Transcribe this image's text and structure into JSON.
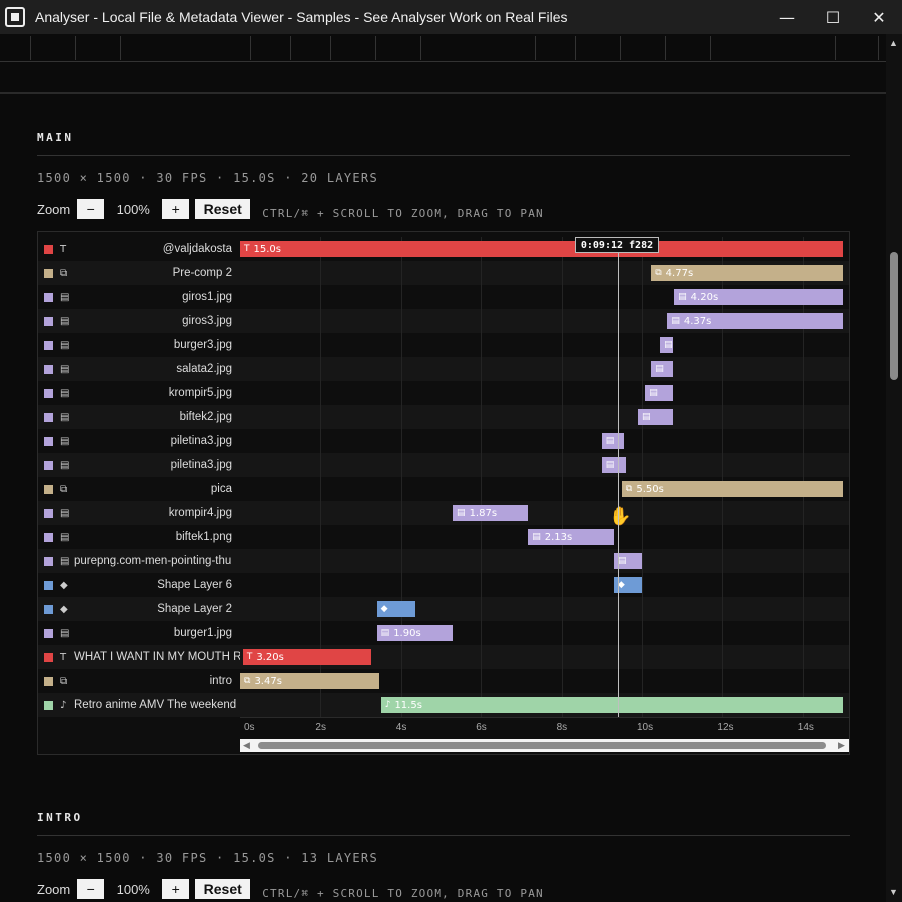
{
  "window": {
    "title": "Analyser - Local File & Metadata Viewer - Samples - See Analyser Work on Real Files",
    "minimize": "—",
    "maximize": "☐",
    "close": "✕"
  },
  "sections": [
    {
      "title": "MAIN",
      "meta": "1500 × 1500 · 30 FPS · 15.0S · 20 LAYERS",
      "zoom": {
        "label": "Zoom",
        "minus": "−",
        "value": "100%",
        "plus": "+",
        "reset": "Reset",
        "hint": "CTRL/⌘ + SCROLL TO ZOOM, DRAG TO PAN"
      }
    },
    {
      "title": "INTRO",
      "meta": "1500 × 1500 · 30 FPS · 15.0S · 13 LAYERS",
      "zoom": {
        "label": "Zoom",
        "minus": "−",
        "value": "100%",
        "plus": "+",
        "reset": "Reset",
        "hint": "CTRL/⌘ + SCROLL TO ZOOM, DRAG TO PAN"
      }
    }
  ],
  "colors": {
    "text": "#e04545",
    "precomp": "#c4b08a",
    "image": "#b3a3db",
    "shape": "#6e9bd6",
    "audio": "#9fd4a8"
  },
  "type_icons": {
    "text": "T",
    "precomp": "⧉",
    "image": "▤",
    "shape": "◆",
    "audio": "♪"
  },
  "timeline": {
    "duration": 15.0,
    "playhead": {
      "time": 9.4,
      "label": "0:09:12 f282"
    },
    "ticks": [
      "0s",
      "2s",
      "4s",
      "6s",
      "8s",
      "10s",
      "12s",
      "14s"
    ],
    "layers": [
      {
        "name": "@valjdakosta",
        "type": "text",
        "start": 0.0,
        "end": 15.0,
        "label": "15.0s"
      },
      {
        "name": "Pre-comp 2",
        "type": "precomp",
        "start": 10.23,
        "end": 15.0,
        "label": "4.77s"
      },
      {
        "name": "giros1.jpg",
        "type": "image",
        "start": 10.8,
        "end": 15.0,
        "label": "4.20s"
      },
      {
        "name": "giros3.jpg",
        "type": "image",
        "start": 10.63,
        "end": 15.0,
        "label": "4.37s"
      },
      {
        "name": "burger3.jpg",
        "type": "image",
        "start": 10.45,
        "end": 10.78,
        "label": ""
      },
      {
        "name": "salata2.jpg",
        "type": "image",
        "start": 10.23,
        "end": 10.78,
        "label": ""
      },
      {
        "name": "krompir5.jpg",
        "type": "image",
        "start": 10.08,
        "end": 10.78,
        "label": ""
      },
      {
        "name": "biftek2.jpg",
        "type": "image",
        "start": 9.9,
        "end": 10.78,
        "label": ""
      },
      {
        "name": "piletina3.jpg",
        "type": "image",
        "start": 9.0,
        "end": 9.55,
        "label": ""
      },
      {
        "name": "piletina3.jpg",
        "type": "image",
        "start": 9.0,
        "end": 9.6,
        "label": ""
      },
      {
        "name": "pica",
        "type": "precomp",
        "start": 9.5,
        "end": 15.0,
        "label": "5.50s"
      },
      {
        "name": "krompir4.jpg",
        "type": "image",
        "start": 5.3,
        "end": 7.17,
        "label": "1.87s"
      },
      {
        "name": "biftek1.png",
        "type": "image",
        "start": 7.17,
        "end": 9.3,
        "label": "2.13s"
      },
      {
        "name": "purepng.com-men-pointing-thu",
        "type": "image",
        "start": 9.3,
        "end": 10.0,
        "label": ""
      },
      {
        "name": "Shape Layer 6",
        "type": "shape",
        "start": 9.3,
        "end": 10.0,
        "label": ""
      },
      {
        "name": "Shape Layer 2",
        "type": "shape",
        "start": 3.4,
        "end": 4.35,
        "label": ""
      },
      {
        "name": "burger1.jpg",
        "type": "image",
        "start": 3.4,
        "end": 5.3,
        "label": "1.90s"
      },
      {
        "name": "WHAT I WANT IN MY MOUTH RIG",
        "type": "text",
        "start": 0.07,
        "end": 3.27,
        "label": "3.20s"
      },
      {
        "name": "intro",
        "type": "precomp",
        "start": 0.0,
        "end": 3.47,
        "label": "3.47s"
      },
      {
        "name": "Retro anime AMV The weekend",
        "type": "audio",
        "start": 3.5,
        "end": 15.0,
        "label": "11.5s"
      }
    ]
  }
}
